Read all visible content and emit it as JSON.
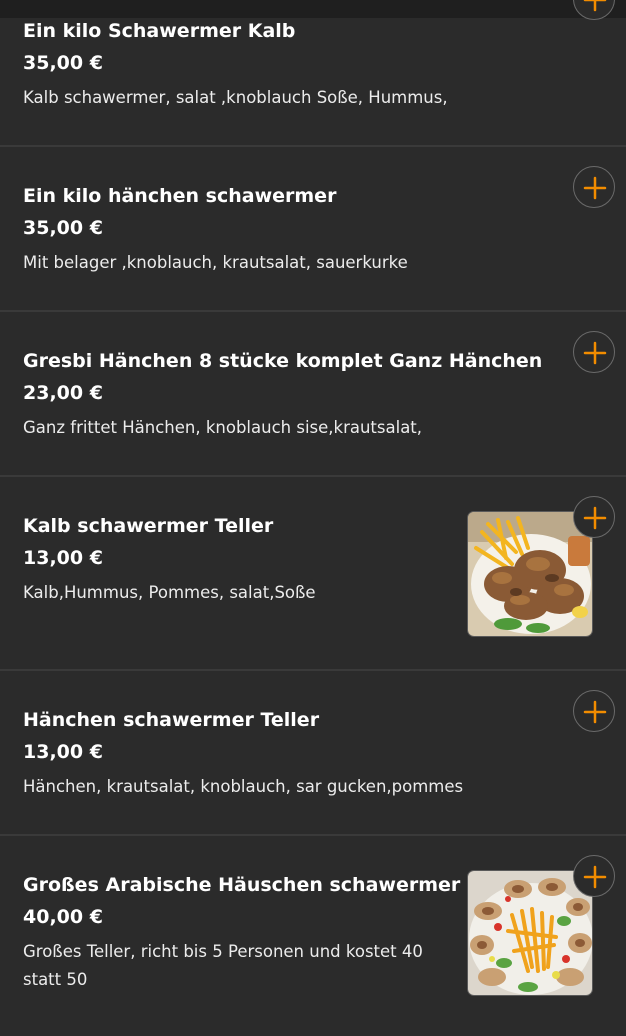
{
  "accent_color": "#f28c00",
  "background_color": "#2b2b2b",
  "items": [
    {
      "title": "Ein kilo Schawermer Kalb",
      "price": "35,00 €",
      "description": "Kalb schawermer, salat ,knoblauch Soße, Hummus,",
      "has_image": false,
      "add_icon": "plus-icon"
    },
    {
      "title": "Ein kilo hänchen schawermer",
      "price": "35,00 €",
      "description": "Mit belager ,knoblauch, krautsalat, sauerkurke",
      "has_image": false,
      "add_icon": "plus-icon"
    },
    {
      "title": "Gresbi Hänchen 8 stücke komplet Ganz Hänchen",
      "price": "23,00 €",
      "description": "Ganz frittet Hänchen, knoblauch sise,krautsalat,",
      "has_image": false,
      "add_icon": "plus-icon"
    },
    {
      "title": "Kalb schawermer Teller",
      "price": "13,00 €",
      "description": "Kalb,Hummus, Pommes, salat,Soße",
      "has_image": true,
      "add_icon": "plus-icon"
    },
    {
      "title": "Hänchen schawermer Teller",
      "price": "13,00 €",
      "description": "Hänchen, krautsalat, knoblauch, sar gucken,pommes",
      "has_image": false,
      "add_icon": "plus-icon"
    },
    {
      "title": "Großes Arabische Häuschen schawermer",
      "price": "40,00 €",
      "description": "Großes Teller, richt bis 5 Personen und kostet 40 statt 50",
      "has_image": true,
      "add_icon": "plus-icon"
    }
  ]
}
